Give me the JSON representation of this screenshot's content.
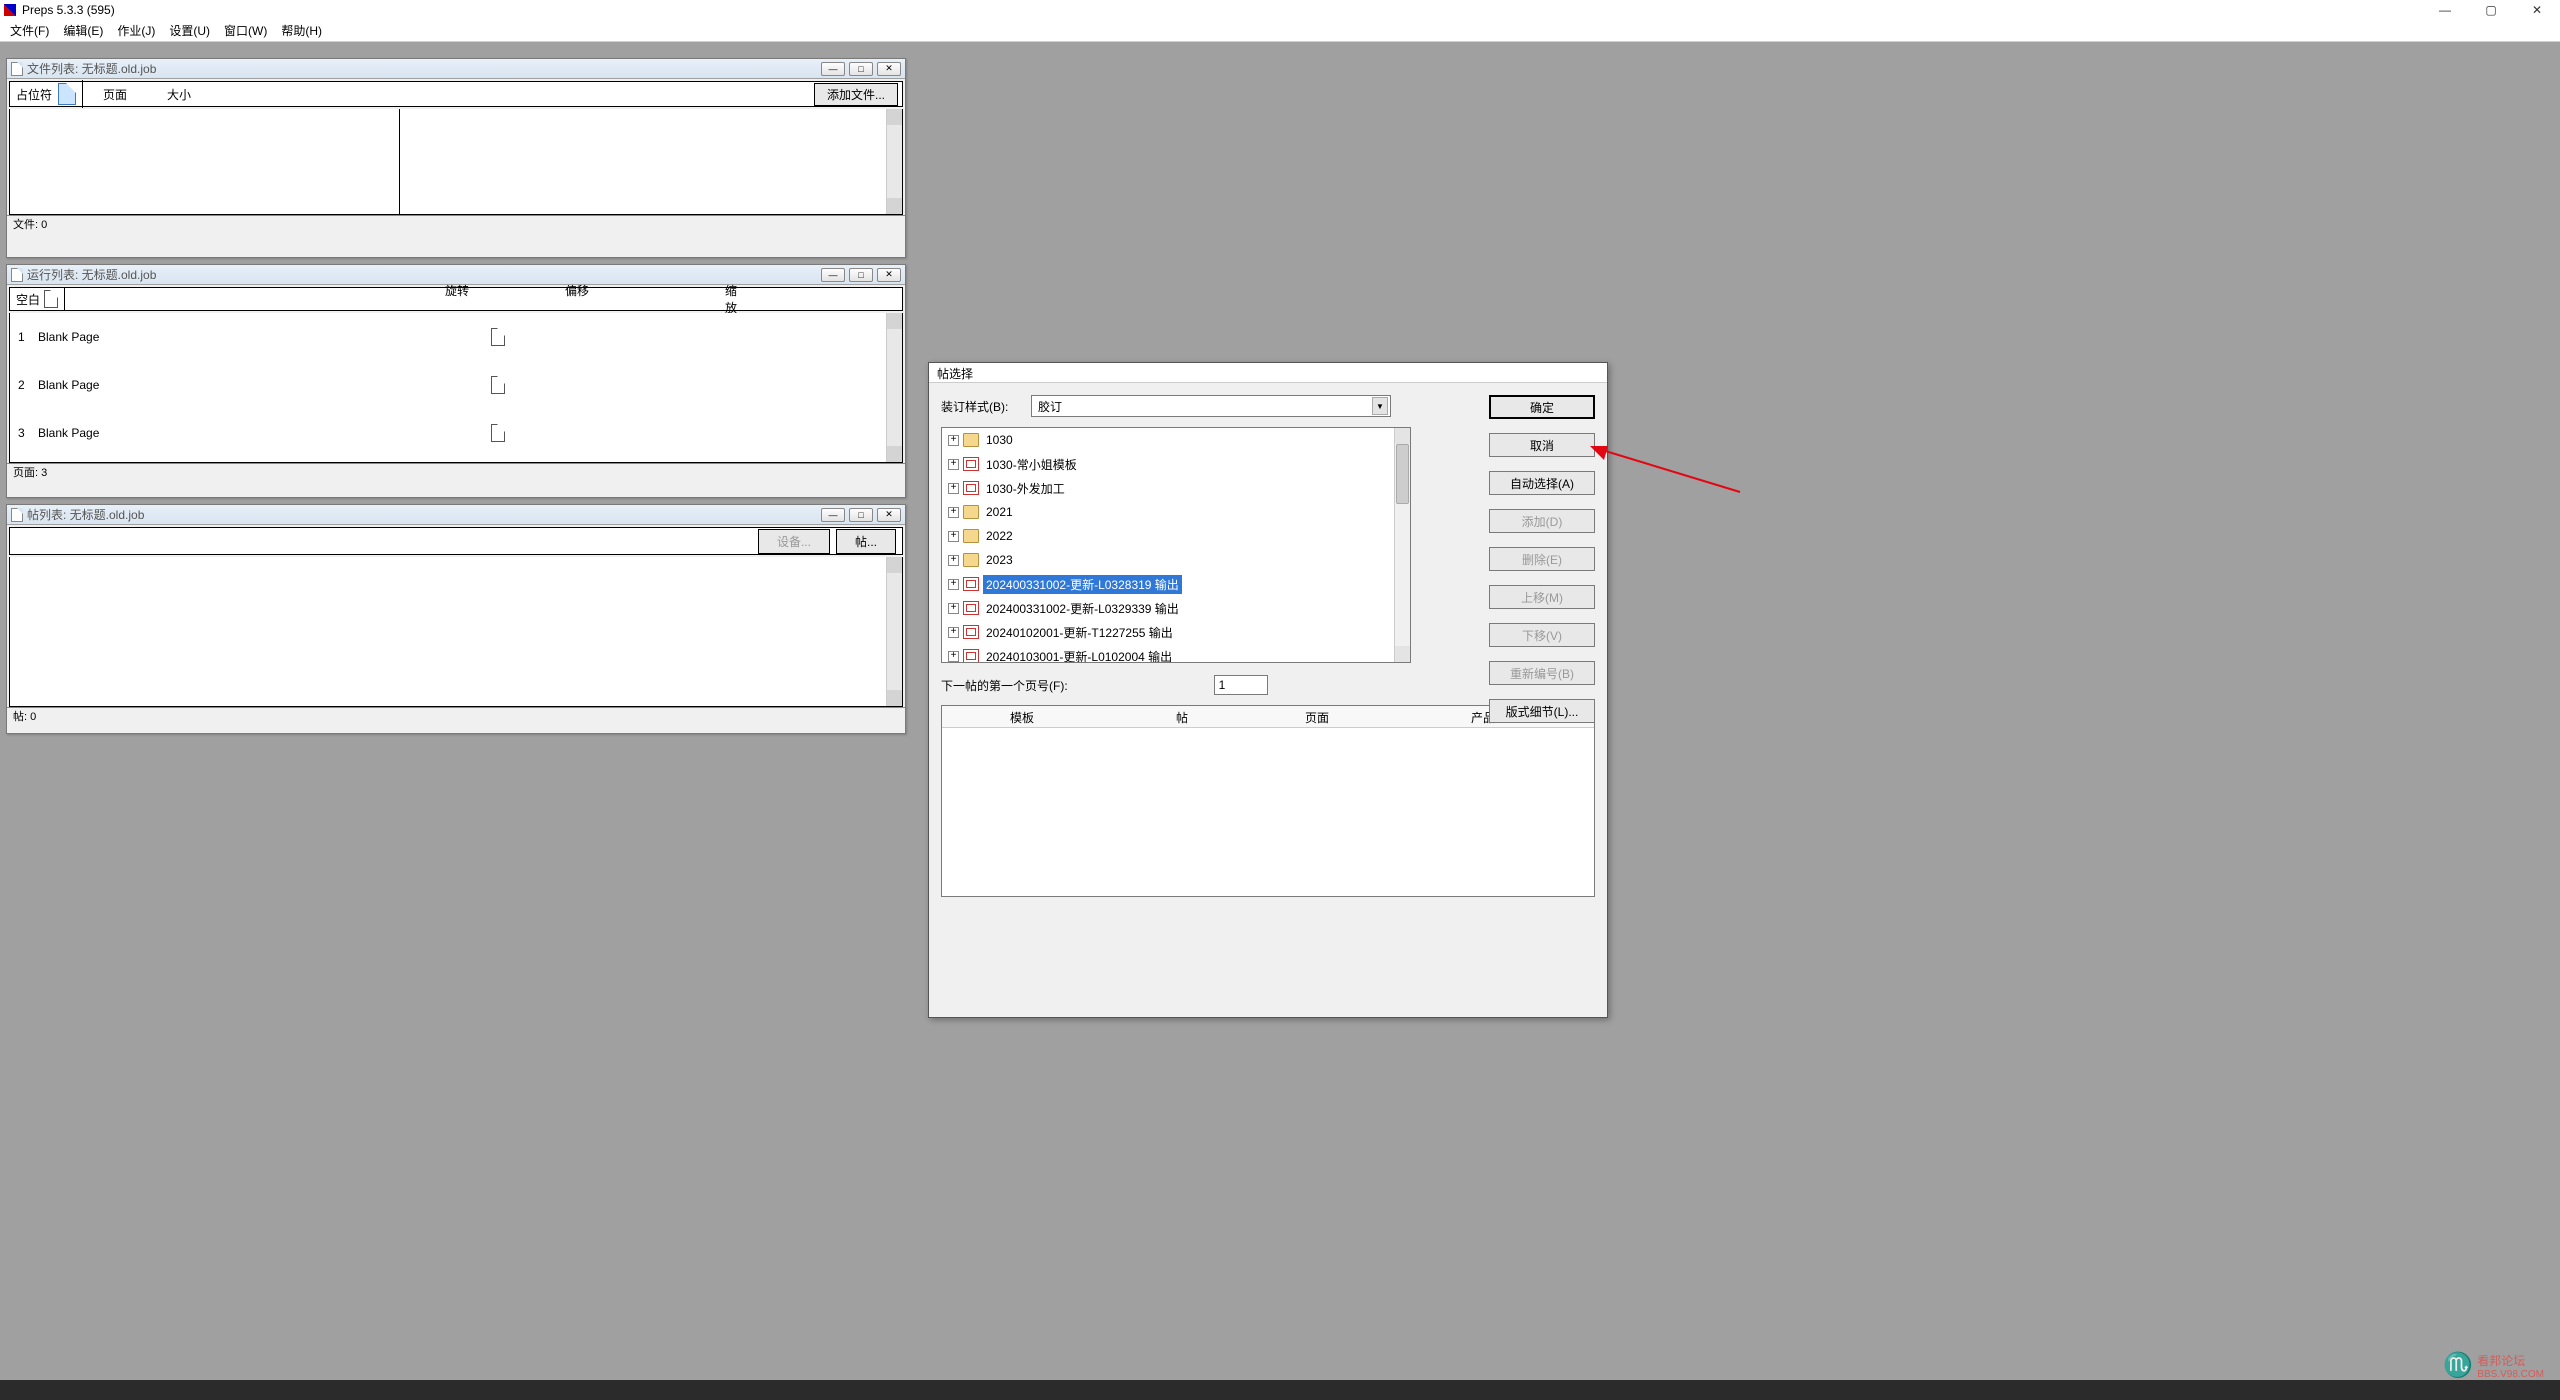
{
  "app": {
    "title": "Preps 5.3.3 (595)"
  },
  "menu": {
    "file": "文件(F)",
    "edit": "编辑(E)",
    "job": "作业(J)",
    "setup": "设置(U)",
    "window": "窗口(W)",
    "help": "帮助(H)"
  },
  "win_filelist": {
    "title": "文件列表: 无标题.old.job",
    "placeholder": "占位符",
    "col_page": "页面",
    "col_size": "大小",
    "btn_add": "添加文件...",
    "status": "文件: 0"
  },
  "win_runlist": {
    "title": "运行列表: 无标题.old.job",
    "blank": "空白",
    "col_rotate": "旋转",
    "col_offset": "偏移",
    "col_scale": "缩放",
    "rows": [
      {
        "num": "1",
        "label": "Blank Page"
      },
      {
        "num": "2",
        "label": "Blank Page"
      },
      {
        "num": "3",
        "label": "Blank Page"
      }
    ],
    "status": "页面: 3"
  },
  "win_siglist": {
    "title": "帖列表: 无标题.old.job",
    "btn_device": "设备...",
    "btn_sig": "帖...",
    "status": "帖: 0"
  },
  "dialog": {
    "title": "帖选择",
    "binding_label": "装订样式(B):",
    "binding_value": "胶订",
    "tree": [
      {
        "type": "folder",
        "label": "1030"
      },
      {
        "type": "tpl",
        "label": "1030-常小姐模板"
      },
      {
        "type": "tpl",
        "label": "1030-外发加工"
      },
      {
        "type": "folder",
        "label": "2021"
      },
      {
        "type": "folder",
        "label": "2022"
      },
      {
        "type": "folder",
        "label": "2023"
      },
      {
        "type": "tpl",
        "label": "202400331002-更新-L0328319 输出",
        "selected": true
      },
      {
        "type": "tpl",
        "label": "202400331002-更新-L0329339 输出"
      },
      {
        "type": "tpl",
        "label": "20240102001-更新-T1227255 输出"
      },
      {
        "type": "tpl",
        "label": "20240103001-更新-L0102004 输出"
      }
    ],
    "buttons": {
      "ok": "确定",
      "cancel": "取消",
      "auto": "自动选择(A)",
      "add": "添加(D)",
      "delete": "删除(E)",
      "up": "上移(M)",
      "down": "下移(V)",
      "renum": "重新编号(B)",
      "detail": "版式细节(L)..."
    },
    "next_label": "下一帖的第一个页号(F):",
    "next_value": "1",
    "cols": {
      "template": "模板",
      "sig": "帖",
      "page": "页面",
      "product": "产品"
    }
  },
  "watermark": {
    "text": "看邦论坛",
    "sub": "BBS.V98.COM"
  }
}
